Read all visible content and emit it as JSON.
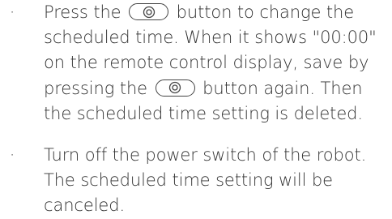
{
  "bullets": [
    {
      "marker": "·",
      "line1_before": "Press the",
      "line1_after": "button to change the",
      "line2": "scheduled time. When it shows \"00:00\"",
      "line3": "on the remote control display, save by",
      "line4_before": "pressing the",
      "line4_after": "button again. Then",
      "line5": "the scheduled time setting is deleted.",
      "icon": "schedule-button-icon"
    },
    {
      "marker": "·",
      "line1": "Turn off the power switch of the robot.",
      "line2": "The scheduled time setting will be",
      "line3": "canceled."
    }
  ]
}
